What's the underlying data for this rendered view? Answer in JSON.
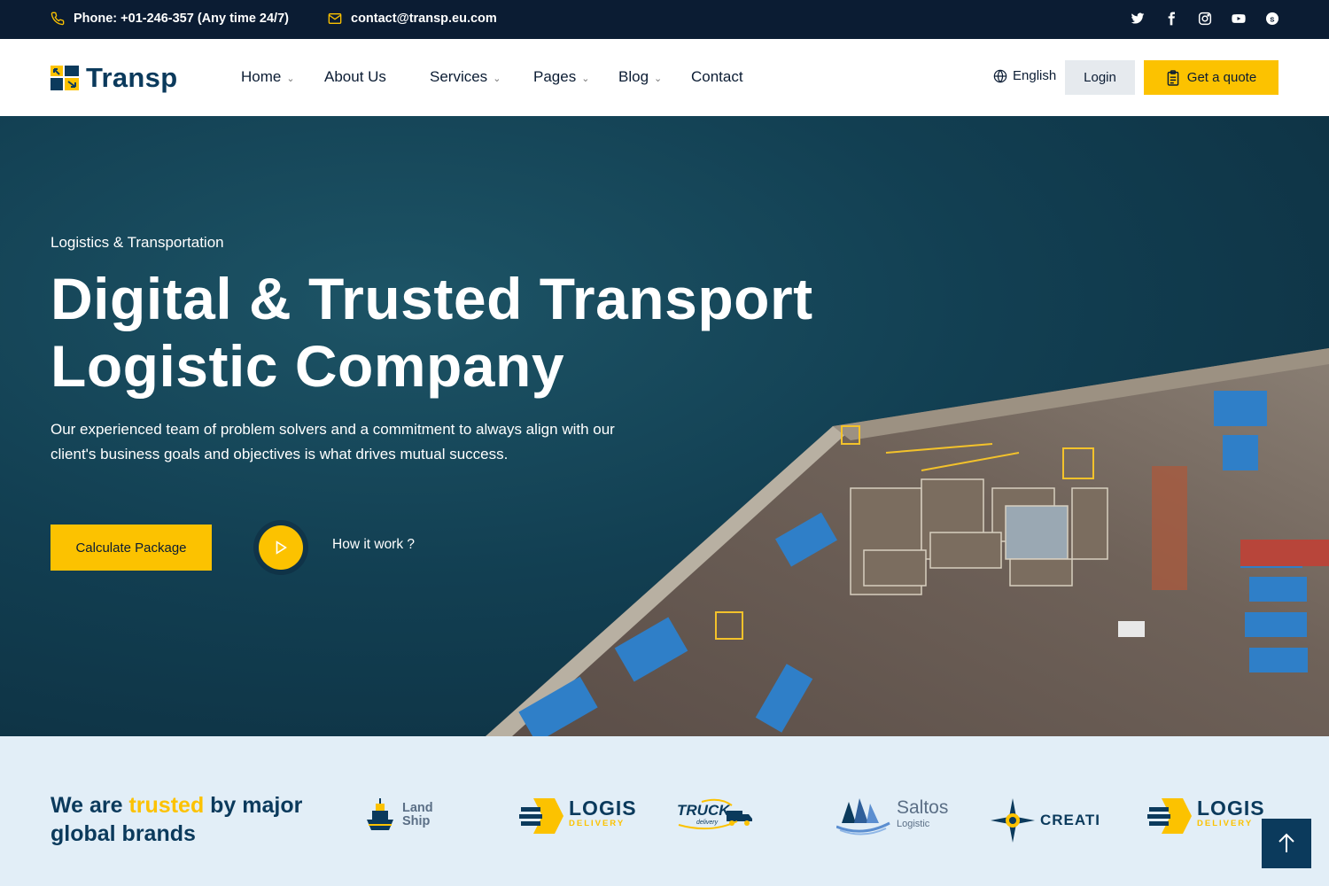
{
  "topbar": {
    "phone": "Phone: +01-246-357 (Any time 24/7)",
    "email": "contact@transp.eu.com",
    "social_icons": [
      "twitter-icon",
      "facebook-icon",
      "instagram-icon",
      "youtube-icon",
      "skype-icon"
    ]
  },
  "header": {
    "brand": "Transp",
    "nav": [
      {
        "label": "Home",
        "dropdown": true
      },
      {
        "label": "About Us",
        "dropdown": false
      },
      {
        "label": "Services",
        "dropdown": true
      },
      {
        "label": "Pages",
        "dropdown": true
      },
      {
        "label": "Blog",
        "dropdown": true
      },
      {
        "label": "Contact",
        "dropdown": false
      }
    ],
    "language": "English",
    "login": "Login",
    "quote": "Get a quote"
  },
  "hero": {
    "eyebrow": "Logistics & Transportation",
    "title_line1": "Digital & Trusted Transport",
    "title_line2": "Logistic Company",
    "desc_line1": "Our experienced team of problem solvers and a commitment to always align with our",
    "desc_line2": "client's business goals and objectives is what drives mutual success.",
    "cta": "Calculate Package",
    "video_link": "How it work ?"
  },
  "brands": {
    "title_pre": "We are ",
    "title_highlight": "trusted",
    "title_post": " by major global brands",
    "logos": [
      {
        "name": "Land Ship",
        "line1": "Land",
        "line2": "Ship"
      },
      {
        "name": "LOGIS DELIVERY",
        "line1": "LOGIS",
        "line2": "DELIVERY"
      },
      {
        "name": "TRUCK delivery",
        "line1": "TRUCK",
        "line2": "delivery"
      },
      {
        "name": "Saltos Logistic",
        "line1": "Saltos",
        "line2": "Logistic"
      },
      {
        "name": "CREATI",
        "line1": "CREATI",
        "line2": ""
      },
      {
        "name": "LOGIS DELIVERY",
        "line1": "LOGIS",
        "line2": "DELIVERY"
      }
    ]
  },
  "colors": {
    "accent": "#fcc200",
    "navy": "#0b1c33",
    "brand_blue": "#0b3a5c",
    "brands_bg": "#e2eef7"
  }
}
